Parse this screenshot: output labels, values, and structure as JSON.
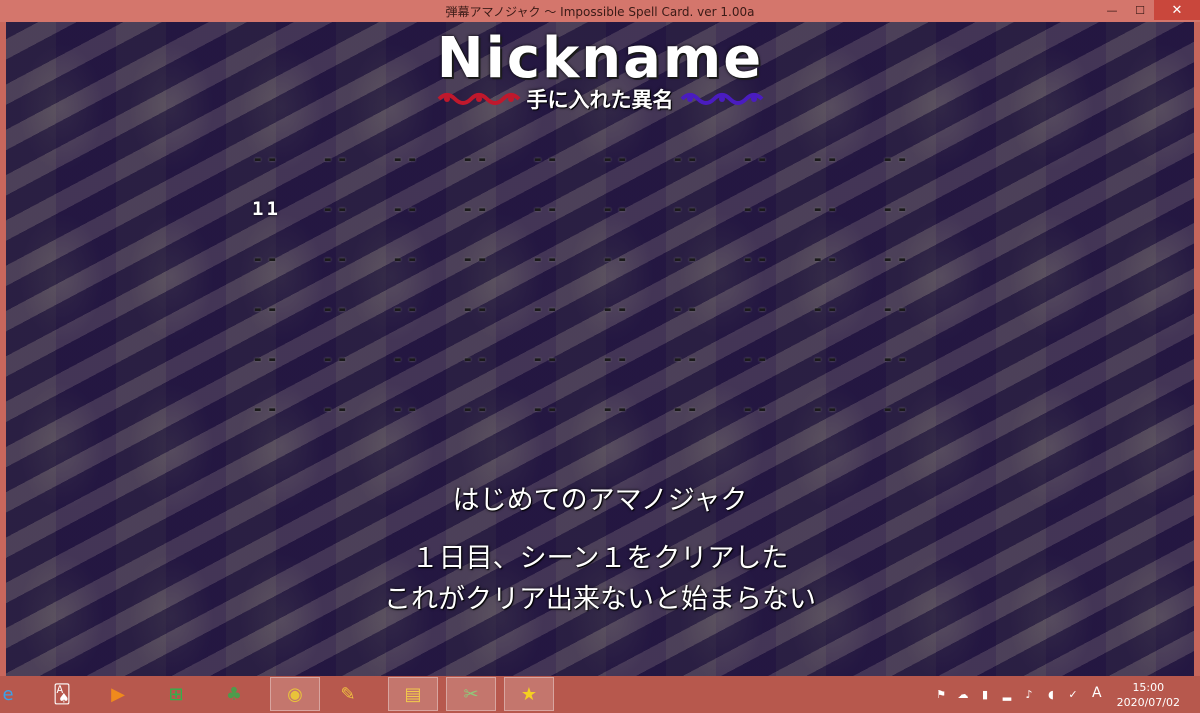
{
  "window": {
    "title": "弾幕アマノジャク ～ Impossible Spell Card. ver 1.00a",
    "minimize_glyph": "—",
    "maximize_glyph": "☐",
    "close_glyph": "✕"
  },
  "game": {
    "logo_title": "Nickname",
    "logo_subtitle": "手に入れた異名",
    "grid": [
      [
        "--",
        "--",
        "--",
        "--",
        "--",
        "--",
        "--",
        "--",
        "--",
        "--"
      ],
      [
        "11",
        "--",
        "--",
        "--",
        "--",
        "--",
        "--",
        "--",
        "--",
        "--"
      ],
      [
        "--",
        "--",
        "--",
        "--",
        "--",
        "--",
        "--",
        "--",
        "--",
        "--"
      ],
      [
        "--",
        "--",
        "--",
        "--",
        "--",
        "--",
        "--",
        "--",
        "--",
        "--"
      ],
      [
        "--",
        "--",
        "--",
        "--",
        "--",
        "--",
        "--",
        "--",
        "--",
        "--"
      ],
      [
        "--",
        "--",
        "--",
        "--",
        "--",
        "--",
        "--",
        "--",
        "--",
        "--"
      ]
    ],
    "selected_name": "はじめてのアマノジャク",
    "description_line1": "１日目、シーン１をクリアした",
    "description_line2": "これがクリア出来ないと始まらない"
  },
  "taskbar": {
    "apps": [
      {
        "name": "ie-icon",
        "glyph": "e",
        "color": "#3aa0e8"
      },
      {
        "name": "solitaire-icon",
        "glyph": "🂡",
        "color": "#fff"
      },
      {
        "name": "media-player-icon",
        "glyph": "▶",
        "color": "#f08a1c"
      },
      {
        "name": "store-icon",
        "glyph": "⊞",
        "color": "#2fb34a"
      },
      {
        "name": "game-icon",
        "glyph": "♣",
        "color": "#4c9c4c"
      },
      {
        "name": "chrome-icon",
        "glyph": "◉",
        "color": "#e9c33a"
      },
      {
        "name": "paint-icon",
        "glyph": "✎",
        "color": "#f0c040"
      },
      {
        "name": "explorer-icon",
        "glyph": "▤",
        "color": "#f2c94c"
      },
      {
        "name": "tool-icon",
        "glyph": "✂",
        "color": "#8fc97a"
      },
      {
        "name": "amanojaku-game-icon",
        "glyph": "★",
        "color": "#f5d020"
      }
    ],
    "ime_indicator": "A",
    "time": "15:00",
    "date": "2020/07/02"
  }
}
